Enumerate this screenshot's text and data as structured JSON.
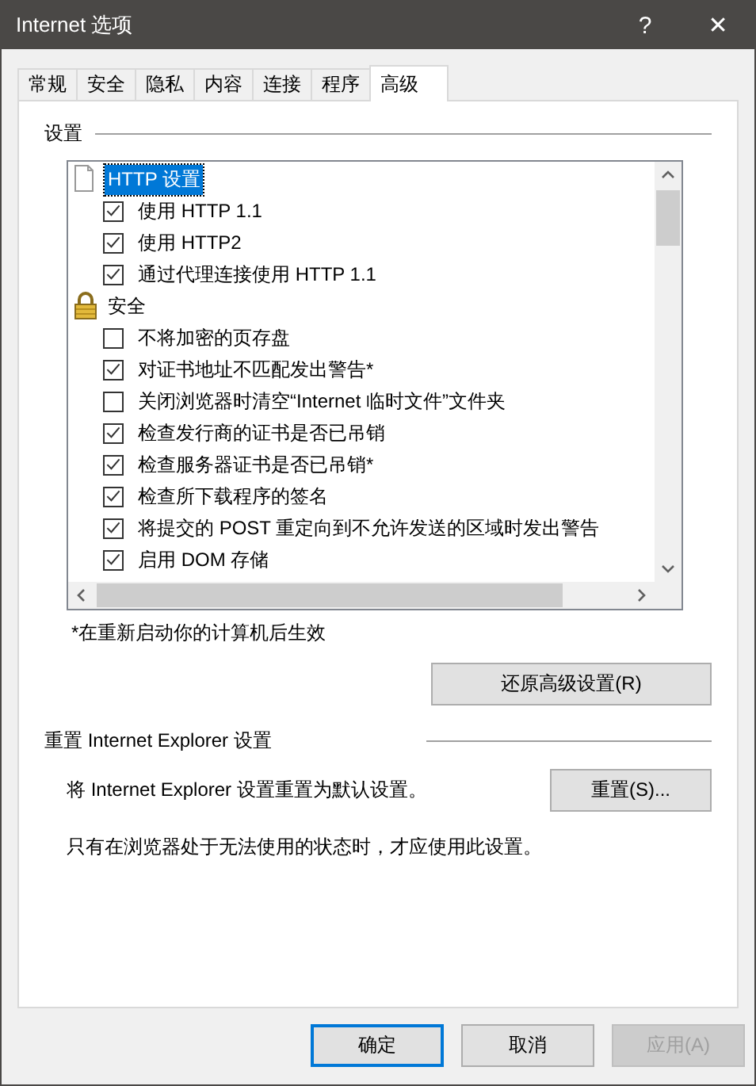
{
  "window": {
    "title": "Internet 选项",
    "help": "?",
    "close": "✕"
  },
  "tabs": [
    {
      "label": "常规",
      "selected": false
    },
    {
      "label": "安全",
      "selected": false
    },
    {
      "label": "隐私",
      "selected": false
    },
    {
      "label": "内容",
      "selected": false
    },
    {
      "label": "连接",
      "selected": false
    },
    {
      "label": "程序",
      "selected": false
    },
    {
      "label": "高级",
      "selected": true
    }
  ],
  "settings": {
    "title": "设置",
    "groups": [
      {
        "label": "HTTP 设置",
        "kind": "page",
        "selected": true,
        "children": [
          {
            "label": "使用 HTTP 1.1",
            "checked": true
          },
          {
            "label": "使用 HTTP2",
            "checked": true
          },
          {
            "label": "通过代理连接使用 HTTP 1.1",
            "checked": true
          }
        ]
      },
      {
        "label": "安全",
        "kind": "lock",
        "selected": false,
        "children": [
          {
            "label": "不将加密的页存盘",
            "checked": false
          },
          {
            "label": "对证书地址不匹配发出警告*",
            "checked": true
          },
          {
            "label": "关闭浏览器时清空“Internet 临时文件”文件夹",
            "checked": false
          },
          {
            "label": "检查发行商的证书是否已吊销",
            "checked": true
          },
          {
            "label": "检查服务器证书是否已吊销*",
            "checked": true
          },
          {
            "label": "检查所下载程序的签名",
            "checked": true
          },
          {
            "label": "将提交的 POST 重定向到不允许发送的区域时发出警告",
            "checked": true
          },
          {
            "label": "启用 DOM 存储",
            "checked": true
          }
        ]
      }
    ],
    "note": "*在重新启动你的计算机后生效",
    "restore_button": "还原高级设置(R)"
  },
  "reset": {
    "title": "重置 Internet Explorer 设置",
    "description": "将 Internet Explorer 设置重置为默认设置。",
    "button": "重置(S)...",
    "note": "只有在浏览器处于无法使用的状态时，才应使用此设置。"
  },
  "buttons": [
    {
      "label": "确定",
      "kind": "default",
      "disabled": false
    },
    {
      "label": "取消",
      "kind": "normal",
      "disabled": false
    },
    {
      "label": "应用(A)",
      "kind": "normal",
      "disabled": true
    }
  ]
}
